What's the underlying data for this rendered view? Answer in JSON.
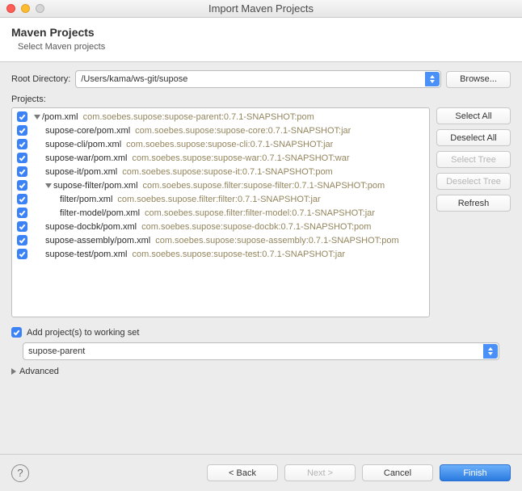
{
  "window": {
    "title": "Import Maven Projects"
  },
  "header": {
    "title": "Maven Projects",
    "subtitle": "Select Maven projects"
  },
  "rootDir": {
    "label": "Root Directory:",
    "value": "/Users/kama/ws-git/supose",
    "browse": "Browse..."
  },
  "projectsLabel": "Projects:",
  "sideButtons": {
    "selectAll": "Select All",
    "deselectAll": "Deselect All",
    "selectTree": "Select Tree",
    "deselectTree": "Deselect Tree",
    "refresh": "Refresh"
  },
  "items": [
    {
      "indent": 0,
      "expander": true,
      "path": "/pom.xml",
      "meta": "com.soebes.supose:supose-parent:0.7.1-SNAPSHOT:pom"
    },
    {
      "indent": 1,
      "expander": false,
      "path": "supose-core/pom.xml",
      "meta": "com.soebes.supose:supose-core:0.7.1-SNAPSHOT:jar"
    },
    {
      "indent": 1,
      "expander": false,
      "path": "supose-cli/pom.xml",
      "meta": "com.soebes.supose:supose-cli:0.7.1-SNAPSHOT:jar"
    },
    {
      "indent": 1,
      "expander": false,
      "path": "supose-war/pom.xml",
      "meta": "com.soebes.supose:supose-war:0.7.1-SNAPSHOT:war"
    },
    {
      "indent": 1,
      "expander": false,
      "path": "supose-it/pom.xml",
      "meta": "com.soebes.supose:supose-it:0.7.1-SNAPSHOT:pom"
    },
    {
      "indent": 1,
      "expander": true,
      "path": "supose-filter/pom.xml",
      "meta": "com.soebes.supose.filter:supose-filter:0.7.1-SNAPSHOT:pom"
    },
    {
      "indent": 2,
      "expander": false,
      "path": "filter/pom.xml",
      "meta": "com.soebes.supose.filter:filter:0.7.1-SNAPSHOT:jar"
    },
    {
      "indent": 2,
      "expander": false,
      "path": "filter-model/pom.xml",
      "meta": "com.soebes.supose.filter:filter-model:0.7.1-SNAPSHOT:jar"
    },
    {
      "indent": 1,
      "expander": false,
      "path": "supose-docbk/pom.xml",
      "meta": "com.soebes.supose:supose-docbk:0.7.1-SNAPSHOT:pom"
    },
    {
      "indent": 1,
      "expander": false,
      "path": "supose-assembly/pom.xml",
      "meta": "com.soebes.supose:supose-assembly:0.7.1-SNAPSHOT:pom"
    },
    {
      "indent": 1,
      "expander": false,
      "path": "supose-test/pom.xml",
      "meta": "com.soebes.supose:supose-test:0.7.1-SNAPSHOT:jar"
    }
  ],
  "workingSet": {
    "label": "Add project(s) to working set",
    "value": "supose-parent"
  },
  "advanced": "Advanced",
  "footer": {
    "back": "< Back",
    "next": "Next >",
    "cancel": "Cancel",
    "finish": "Finish"
  }
}
